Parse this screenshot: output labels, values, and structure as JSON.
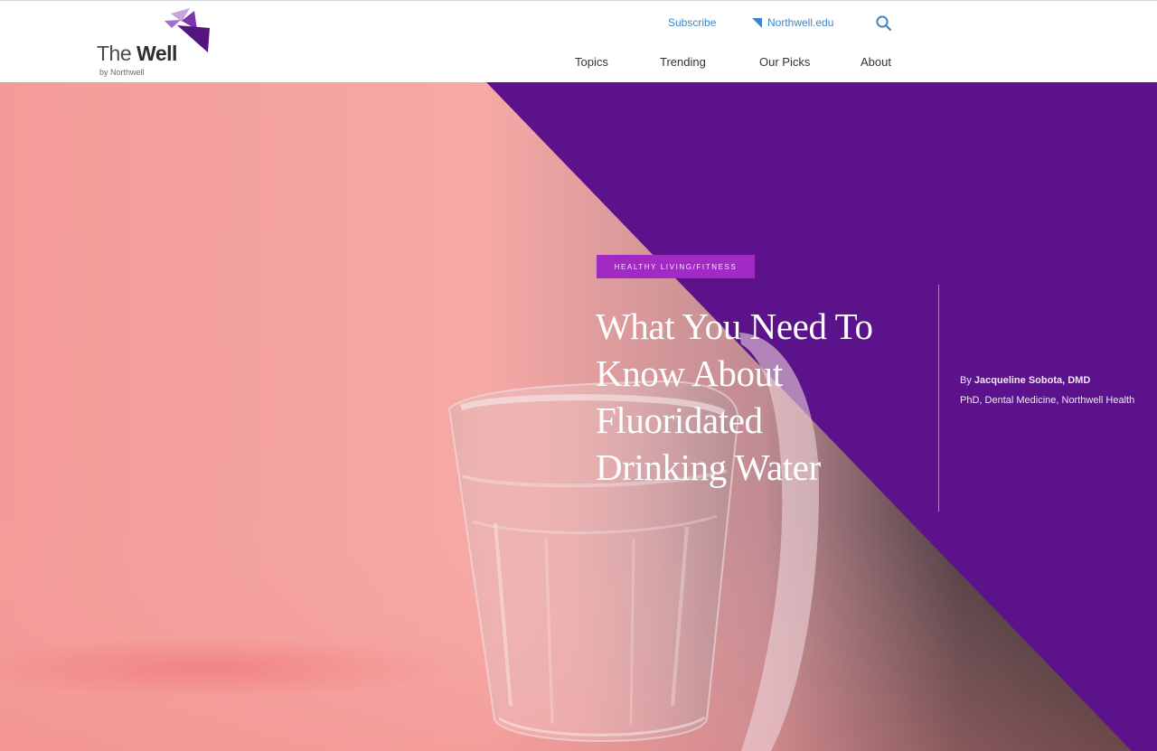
{
  "header": {
    "logo": {
      "title_light": "The",
      "title_bold": "Well",
      "subtitle": "by Northwell"
    },
    "utility": {
      "subscribe": "Subscribe",
      "northwell_link": "Northwell.edu",
      "search_icon": "search-icon"
    },
    "nav": [
      {
        "label": "Topics"
      },
      {
        "label": "Trending"
      },
      {
        "label": "Our Picks"
      },
      {
        "label": "About"
      }
    ]
  },
  "article": {
    "category": "HEALTHY LIVING/FITNESS",
    "headline": "What You Need To Know About Fluoridated Drinking Water",
    "byline": {
      "prefix": "By",
      "author": "Jacqueline Sobota, DMD",
      "credentials": "PhD, Dental Medicine, Northwell Health"
    }
  },
  "colors": {
    "brand_purple": "#5a138b",
    "category_badge": "#a129c4",
    "link_blue": "#3b86c8",
    "pink_background": "#f5a29d"
  }
}
